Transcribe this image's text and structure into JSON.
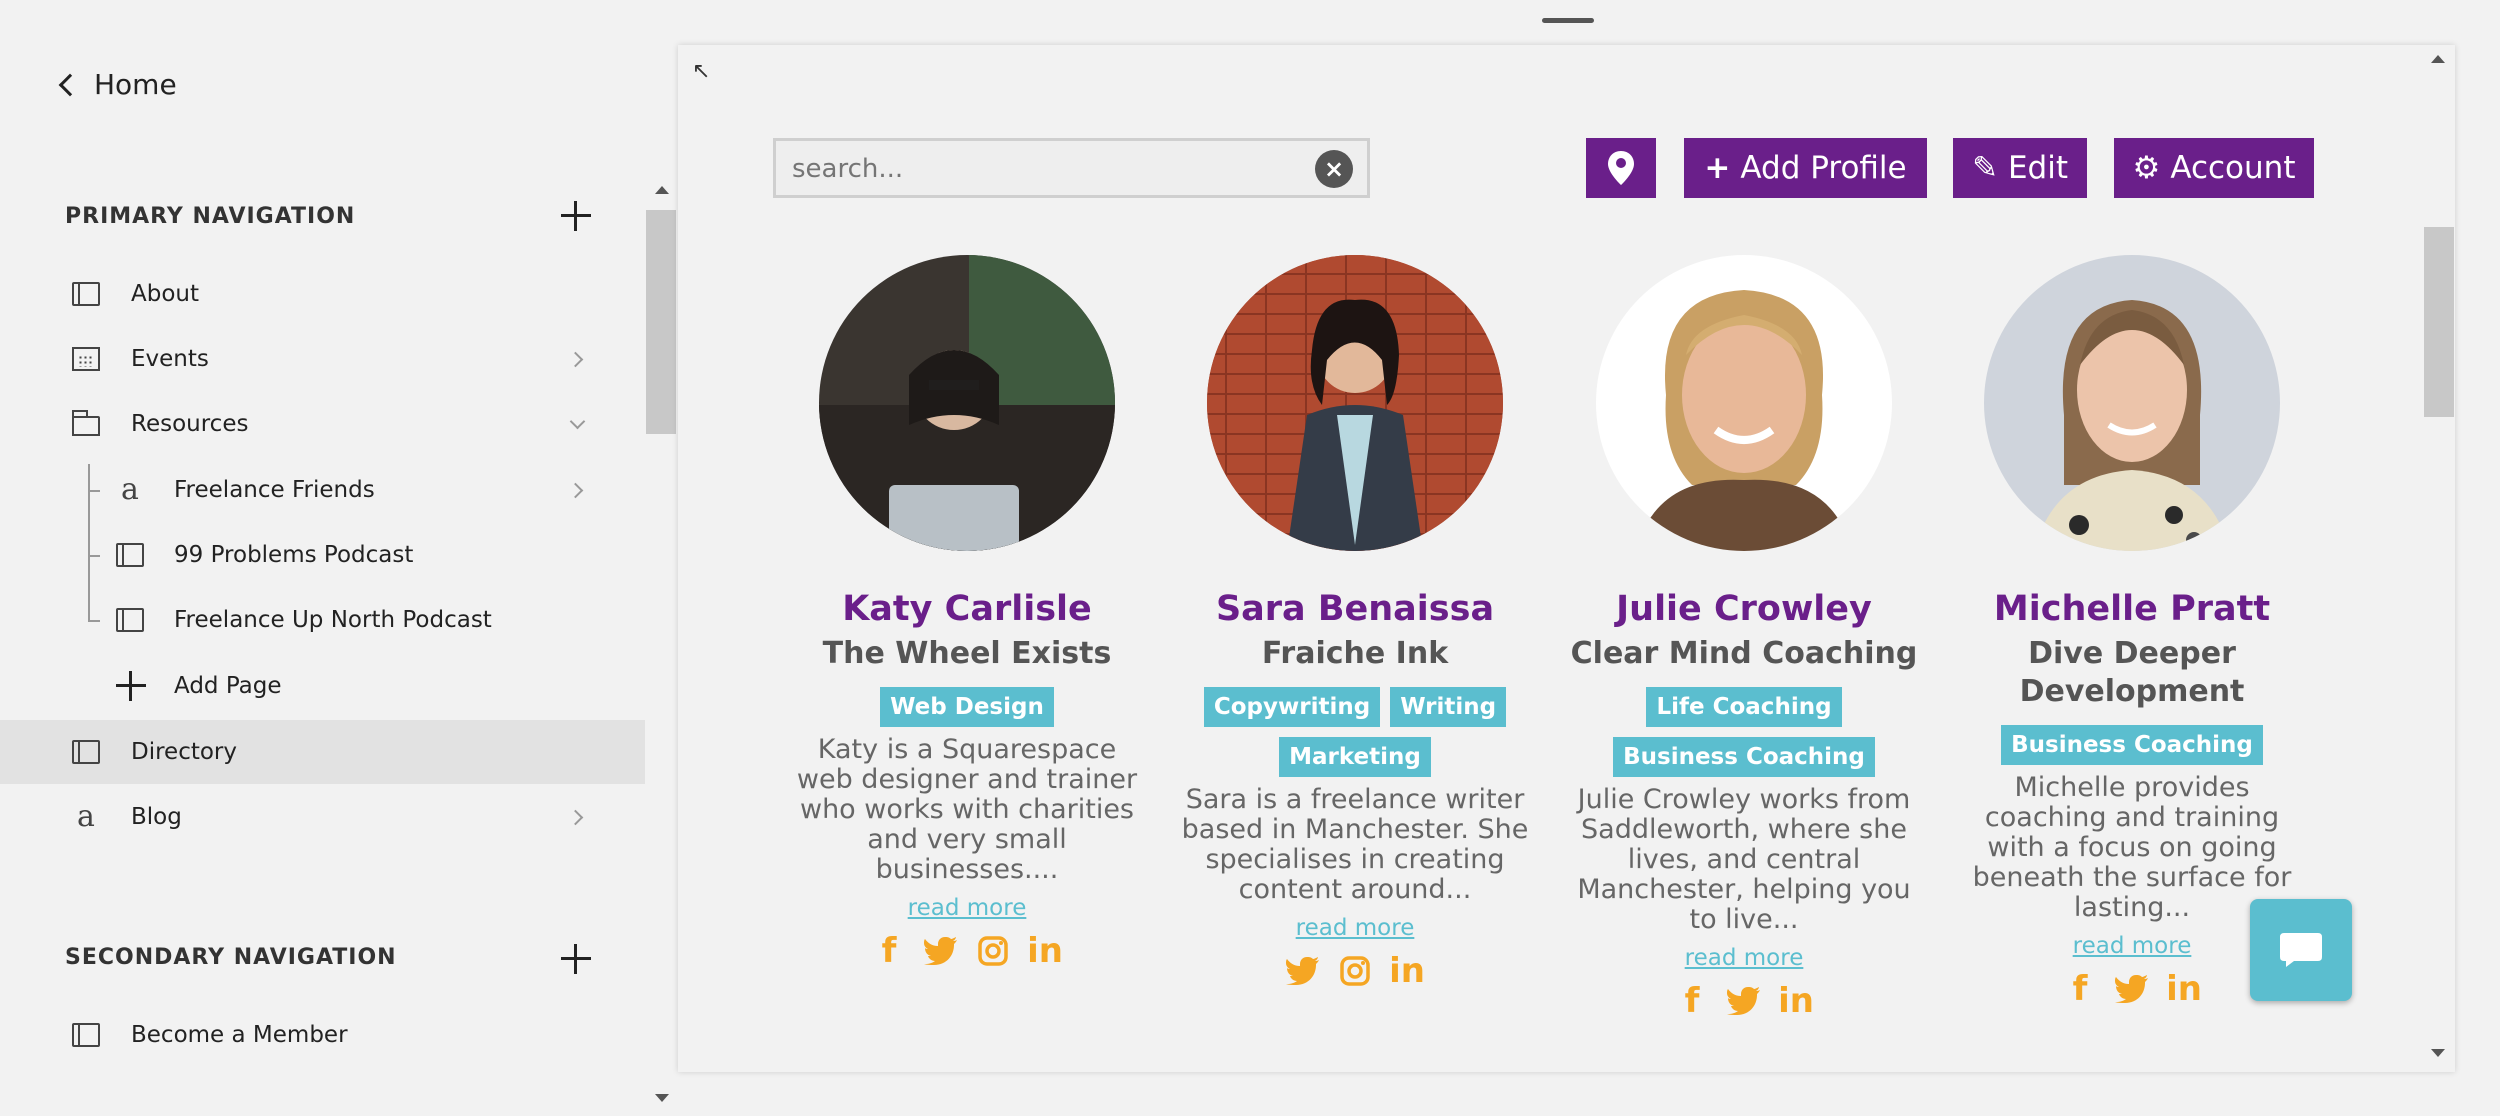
{
  "sidebar": {
    "home_label": "Home",
    "primary_title": "PRIMARY NAVIGATION",
    "secondary_title": "SECONDARY NAVIGATION",
    "items": [
      {
        "label": "About",
        "icon": "page-icon"
      },
      {
        "label": "Events",
        "icon": "calendar-icon"
      },
      {
        "label": "Resources",
        "icon": "folder-icon"
      },
      {
        "label": "Freelance Friends",
        "icon": "link-icon"
      },
      {
        "label": "99 Problems Podcast",
        "icon": "page-icon"
      },
      {
        "label": "Freelance Up North Podcast",
        "icon": "page-icon"
      },
      {
        "label": "Add Page",
        "icon": "plus-icon"
      },
      {
        "label": "Directory",
        "icon": "page-icon"
      },
      {
        "label": "Blog",
        "icon": "link-icon"
      }
    ],
    "secondary_items": [
      {
        "label": "Become a Member",
        "icon": "page-icon"
      }
    ]
  },
  "directory": {
    "search_placeholder": "search...",
    "buttons": {
      "add_profile": "Add Profile",
      "edit": "Edit",
      "account": "Account"
    },
    "profiles": [
      {
        "name": "Katy Carlisle",
        "company": "The Wheel Exists",
        "tags": [
          "Web Design"
        ],
        "description": "Katy is a Squarespace web designer and trainer who works with charities and very small businesses....",
        "read_more": "read more",
        "socials": [
          "facebook-icon",
          "twitter-icon",
          "instagram-icon",
          "linkedin-icon"
        ]
      },
      {
        "name": "Sara Benaissa",
        "company": "Fraiche Ink",
        "tags": [
          "Copywriting",
          "Writing",
          "Marketing"
        ],
        "description": "Sara is a freelance writer based in Manchester. She specialises in creating content around...",
        "read_more": "read more",
        "socials": [
          "twitter-icon",
          "instagram-icon",
          "linkedin-icon"
        ]
      },
      {
        "name": "Julie Crowley",
        "company": "Clear Mind Coaching",
        "tags": [
          "Life Coaching",
          "Business Coaching"
        ],
        "description": "Julie Crowley works from Saddleworth, where she lives, and central Manchester, helping you to live...",
        "read_more": "read more",
        "socials": [
          "facebook-icon",
          "twitter-icon",
          "linkedin-icon"
        ]
      },
      {
        "name": "Michelle Pratt",
        "company": "Dive Deeper Development",
        "tags": [
          "Business Coaching"
        ],
        "description": "Michelle provides coaching and training with a focus on going beneath the surface for lasting...",
        "read_more": "read more",
        "socials": [
          "facebook-icon",
          "twitter-icon",
          "linkedin-icon"
        ]
      }
    ]
  },
  "colors": {
    "brand_purple": "#6a1f8a",
    "tag_teal": "#5bbecf",
    "social_orange": "#f5a623"
  }
}
